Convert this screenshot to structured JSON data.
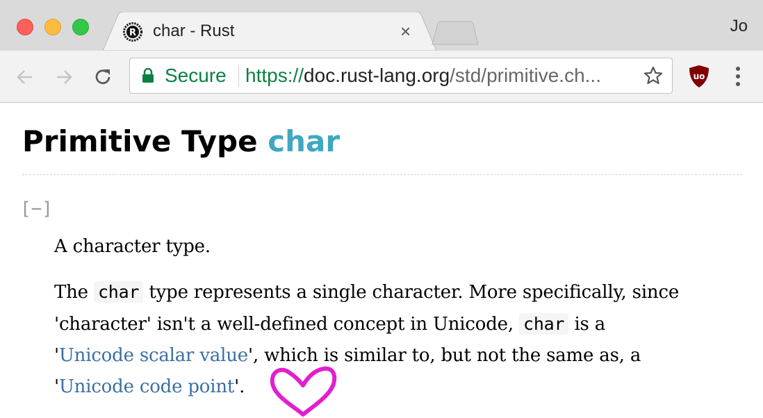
{
  "browser": {
    "tab": {
      "title": "char - Rust",
      "favicon": "rust-logo-icon",
      "close_glyph": "×"
    },
    "profile_name": "Jo",
    "address_bar": {
      "secure_label": "Secure",
      "url_scheme": "https://",
      "url_host": "doc.rust-lang.org",
      "url_path": "/std/primitive.ch..."
    },
    "extension": "ublock-origin-icon",
    "colors": {
      "secure_green": "#0b8043",
      "link_blue": "#3a6fa6",
      "keyword_teal": "#3fa7c2",
      "annotation_magenta": "#e11fd0"
    }
  },
  "page": {
    "heading_prefix": "Primitive Type ",
    "heading_name": "char",
    "collapse_toggle": "[−]",
    "summary": "A character type.",
    "body": {
      "line1_before": "The ",
      "line1_code": "char",
      "line1_after": " type represents a single character. More specifically, since",
      "line2_before": "'character' isn't a well-defined concept in Unicode, ",
      "line2_code": "char",
      "line2_after": " is a",
      "line3_before": "'",
      "line3_link": "Unicode scalar value",
      "line3_after": "', which is similar to, but not the same as, a",
      "line4_before": "'",
      "line4_link": "Unicode code point",
      "line4_after": "'."
    },
    "annotation": "heart-drawing"
  }
}
